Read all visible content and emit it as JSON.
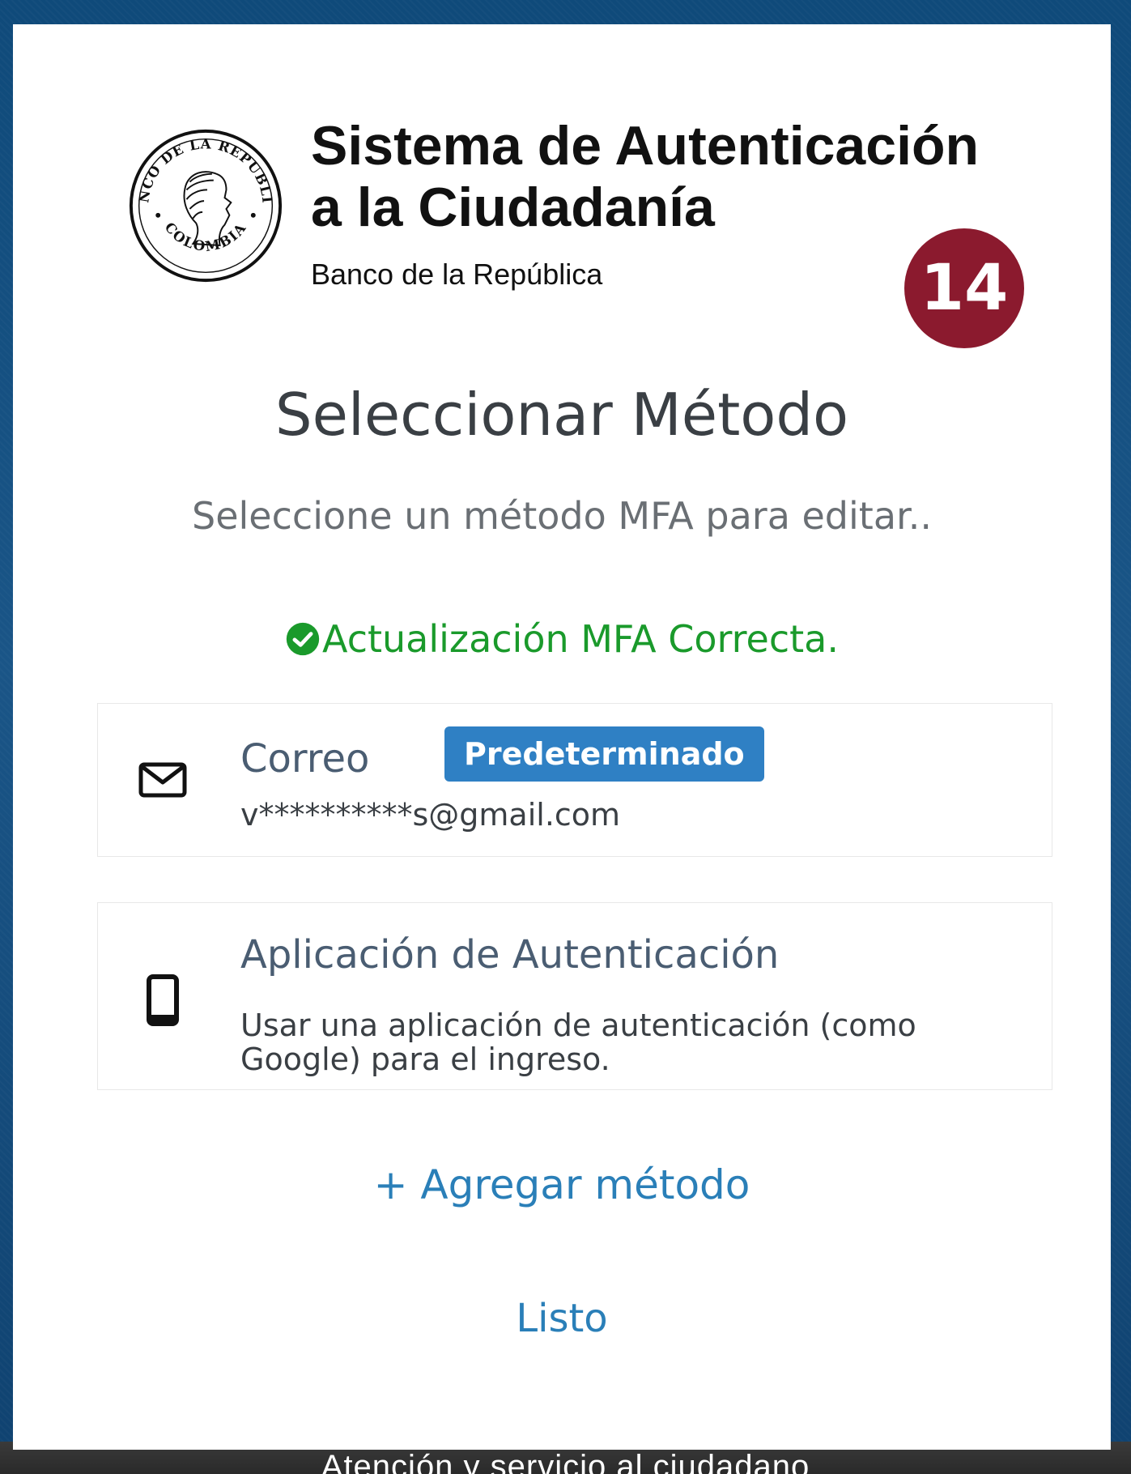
{
  "header": {
    "system_title": "Sistema de Autenticación a la Ciudadanía",
    "system_subtitle": "Banco de la República",
    "seal_texts": [
      "BANCO DE LA REPUBLICA",
      "COLOMBIA"
    ]
  },
  "step_badge": "14",
  "page": {
    "title": "Seleccionar Método",
    "instructions": "Seleccione un método MFA para editar..",
    "success_message": "Actualización MFA Correcta."
  },
  "methods": [
    {
      "icon": "envelope-icon",
      "name": "Correo",
      "badge": "Predeterminado",
      "detail": "v**********s@gmail.com"
    },
    {
      "icon": "mobile-phone-icon",
      "name": "Aplicación de Autenticación",
      "detail": "Usar una aplicación de autenticación (como Google) para el ingreso."
    }
  ],
  "actions": {
    "add_method": "+ Agregar método",
    "done": "Listo"
  },
  "footer": {
    "text": "Atención y servicio al ciudadano"
  },
  "colors": {
    "background": "#1c4d7a",
    "step_badge": "#8b1a2e",
    "success": "#1a9a2b",
    "default_badge": "#2f80c4",
    "link": "#2a7fb8"
  }
}
